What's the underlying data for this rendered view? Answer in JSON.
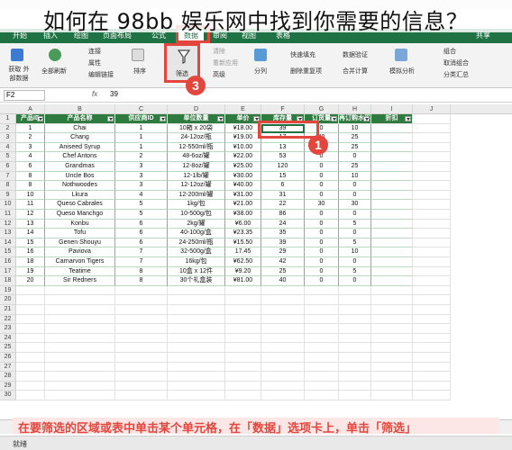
{
  "title_overlay": "如何在 98bb 娱乐网中找到你需要的信息？",
  "ribbon": {
    "tabs": [
      "开始",
      "插入",
      "绘图",
      "页面布局",
      "公式",
      "数据",
      "审阅",
      "视图",
      "表格"
    ],
    "active_tab": "数据",
    "share_label": "共享",
    "items": [
      "获取\n外部数据",
      "全部刷新",
      "连接",
      "属性",
      "编辑链接",
      "排序",
      "筛选",
      "清除",
      "重新应用",
      "高级",
      "分列",
      "快速填充",
      "删除重复项",
      "数据验证",
      "合并计算",
      "模拟分析",
      "组合",
      "取消组合",
      "分类汇总"
    ],
    "filter_label": "筛选"
  },
  "formula_bar": {
    "cell_ref": "F2",
    "fx": "fx",
    "value": "39"
  },
  "columns": [
    "A",
    "B",
    "C",
    "D",
    "E",
    "F",
    "G",
    "H",
    "I",
    "J"
  ],
  "headers": [
    "产品ID",
    "产品名称",
    "供应商ID",
    "单位数量",
    "单价",
    "库存量",
    "订货量",
    "再订购水平",
    "折扣"
  ],
  "rows": [
    [
      "1",
      "Chai",
      "1",
      "10箱 x 20袋",
      "¥18.00",
      "39",
      "0",
      "10",
      ""
    ],
    [
      "2",
      "Chang",
      "1",
      "24-12oz/瓶",
      "¥19.00",
      "17",
      "40",
      "25",
      ""
    ],
    [
      "3",
      "Aniseed Syrup",
      "1",
      "12-550ml/瓶",
      "¥10.00",
      "13",
      "70",
      "25",
      ""
    ],
    [
      "4",
      "Chef Antons",
      "2",
      "48-6oz/罐",
      "¥22.00",
      "53",
      "0",
      "0",
      ""
    ],
    [
      "6",
      "Grandmas",
      "3",
      "12-8oz/罐",
      "¥25.00",
      "120",
      "0",
      "25",
      ""
    ],
    [
      "8",
      "Uncle Bos",
      "3",
      "12-1lb/罐",
      "¥30.00",
      "15",
      "0",
      "10",
      ""
    ],
    [
      "8",
      "Nothwoodes",
      "3",
      "12-12oz/罐",
      "¥40.00",
      "6",
      "0",
      "0",
      ""
    ],
    [
      "10",
      "Lkura",
      "4",
      "12-200ml/罐",
      "¥31.00",
      "31",
      "0",
      "0",
      ""
    ],
    [
      "11",
      "Queso Cabrales",
      "5",
      "1kg/包",
      "¥21.00",
      "22",
      "30",
      "30",
      ""
    ],
    [
      "12",
      "Queso Manchgo",
      "5",
      "10-500g/包",
      "¥38.00",
      "86",
      "0",
      "0",
      ""
    ],
    [
      "13",
      "Konbu",
      "6",
      "2kg/罐",
      "¥6.00",
      "24",
      "0",
      "5",
      ""
    ],
    [
      "14",
      "Tofu",
      "6",
      "40-100g/盒",
      "¥23.35",
      "35",
      "0",
      "0",
      ""
    ],
    [
      "15",
      "Genen Shouyu",
      "6",
      "24-250ml/瓶",
      "¥15.50",
      "39",
      "0",
      "5",
      ""
    ],
    [
      "16",
      "Paviova",
      "7",
      "32-500g/盒",
      "17.45",
      "29",
      "0",
      "10",
      ""
    ],
    [
      "18",
      "Carnarvon Tigers",
      "7",
      "16kg/包",
      "¥62.50",
      "42",
      "0",
      "0",
      ""
    ],
    [
      "19",
      "Teatime",
      "8",
      "10盒 x 12件",
      "¥9.20",
      "25",
      "0",
      "5",
      ""
    ],
    [
      "20",
      "Sir Redners",
      "8",
      "30个礼盒装",
      "¥81.00",
      "40",
      "0",
      "0",
      ""
    ]
  ],
  "row_numbers": [
    "1",
    "2",
    "3",
    "4",
    "5",
    "6",
    "7",
    "8",
    "9",
    "10",
    "11",
    "12",
    "13",
    "14",
    "15",
    "16",
    "17",
    "18",
    "19",
    "20",
    "21",
    "22",
    "23",
    "24",
    "25",
    "26",
    "27",
    "28",
    "29",
    "30"
  ],
  "badges": [
    "1",
    "3"
  ],
  "bottom_banner": "在要筛选的区域或表中单击某个单元格，在「数据」选项卡上，单击「筛选」",
  "status": "就绪",
  "colors": {
    "accent": "#1f7244",
    "highlight": "#e2463d",
    "header_fill": "#2f7a3f"
  }
}
